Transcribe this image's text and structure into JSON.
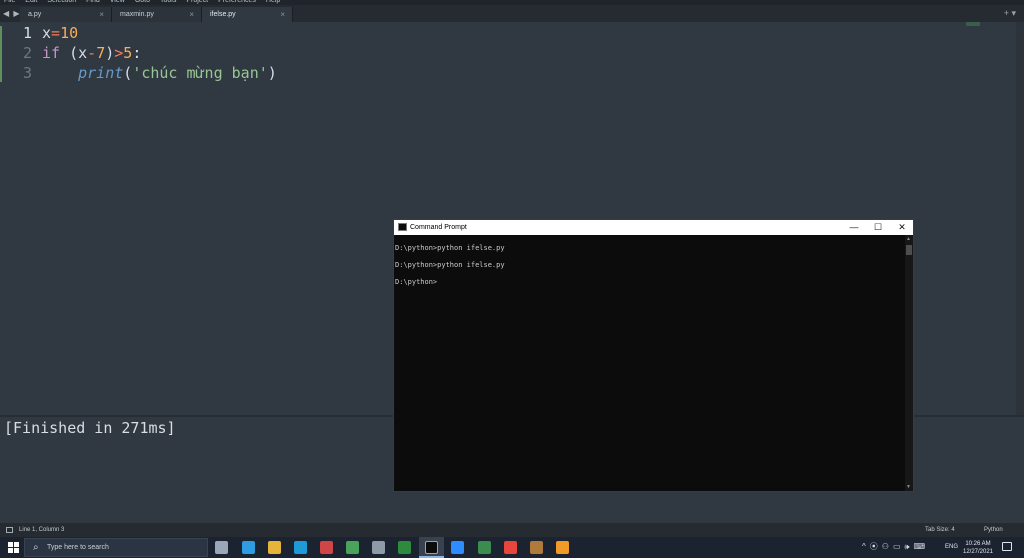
{
  "menubar": {
    "items": [
      "File",
      "Edit",
      "Selection",
      "Find",
      "View",
      "Goto",
      "Tools",
      "Project",
      "Preferences",
      "Help"
    ]
  },
  "tabs": [
    {
      "label": "a.py",
      "active": false
    },
    {
      "label": "maxmin.py",
      "active": false
    },
    {
      "label": "ifelse.py",
      "active": true
    }
  ],
  "tab_nav_glyph": "◀ ▶",
  "tab_close_glyph": "×",
  "tab_add_glyph": "+ ▾",
  "editor": {
    "line_numbers": [
      "1",
      "2",
      "3"
    ],
    "lines": [
      {
        "tokens": [
          {
            "t": "x",
            "c": ""
          },
          {
            "t": "=",
            "c": "op"
          },
          {
            "t": "10",
            "c": "num"
          }
        ]
      },
      {
        "tokens": [
          {
            "t": "if",
            "c": "kw"
          },
          {
            "t": " (x",
            "c": ""
          },
          {
            "t": "-",
            "c": "op"
          },
          {
            "t": "7",
            "c": "num"
          },
          {
            "t": ")",
            "c": ""
          },
          {
            "t": ">",
            "c": "op"
          },
          {
            "t": "5",
            "c": "num"
          },
          {
            "t": ":",
            "c": ""
          }
        ]
      },
      {
        "tokens": [
          {
            "t": "    ",
            "c": ""
          },
          {
            "t": "print",
            "c": "fn"
          },
          {
            "t": "(",
            "c": ""
          },
          {
            "t": "'chúc mừng bạn'",
            "c": "str"
          },
          {
            "t": ")",
            "c": ""
          }
        ]
      }
    ]
  },
  "output": {
    "text": "[Finished in 271ms]"
  },
  "status": {
    "position": "Line 1, Column 3",
    "tab_size": "Tab Size: 4",
    "syntax": "Python"
  },
  "cmd": {
    "title": "Command Prompt",
    "minimize_glyph": "—",
    "maximize_glyph": "☐",
    "close_glyph": "✕",
    "lines": [
      "D:\\python>python ifelse.py",
      "",
      "D:\\python>python ifelse.py",
      "",
      "D:\\python>"
    ]
  },
  "taskbar": {
    "search_placeholder": "Type here to search",
    "search_glyph": "⌕",
    "apps": [
      {
        "name": "task-view-icon",
        "color": "#9aa7b8"
      },
      {
        "name": "edge-icon",
        "color": "#2f9be0"
      },
      {
        "name": "file-explorer-icon",
        "color": "#e6b33b"
      },
      {
        "name": "skype-icon",
        "color": "#1e9bd7"
      },
      {
        "name": "app-red-icon",
        "color": "#d04545"
      },
      {
        "name": "app-green-icon",
        "color": "#4aa35a"
      },
      {
        "name": "app-gray-icon",
        "color": "#8f9aa8"
      },
      {
        "name": "app-green2-icon",
        "color": "#2e8b3d"
      },
      {
        "name": "command-prompt-icon",
        "color": "#0c0c0c"
      },
      {
        "name": "zoom-icon",
        "color": "#2d8cff"
      },
      {
        "name": "app-terminal-icon",
        "color": "#3d8c4f"
      },
      {
        "name": "chrome-icon",
        "color": "#e8453c"
      },
      {
        "name": "app-box-icon",
        "color": "#b07a3b"
      },
      {
        "name": "sublime-text-icon",
        "color": "#f09a29"
      }
    ],
    "tray_glyphs": [
      "^",
      "⦿",
      "⚇",
      "▭",
      "🕪",
      "⌨"
    ],
    "language": "ENG",
    "time": "10:26 AM",
    "date": "12/27/2021"
  }
}
